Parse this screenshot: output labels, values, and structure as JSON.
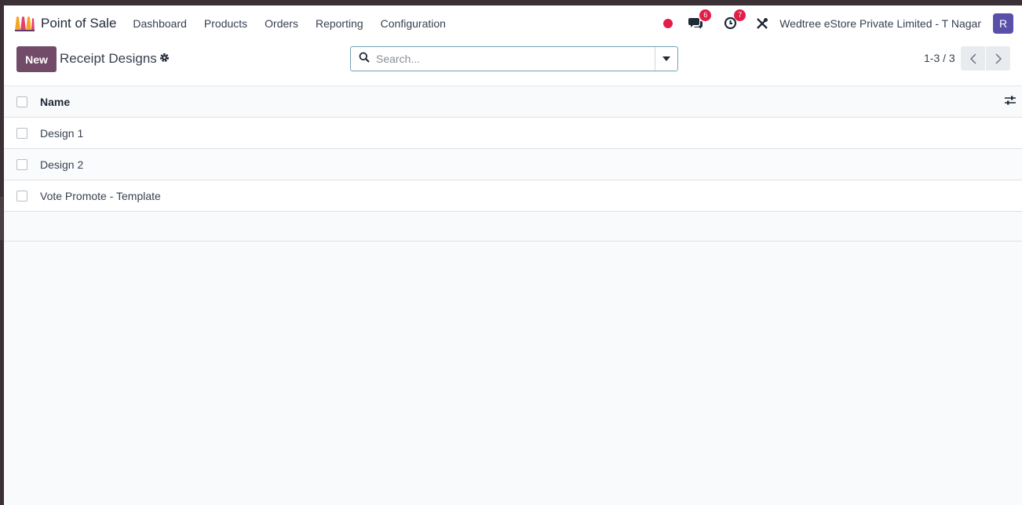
{
  "app": {
    "name": "Point of Sale"
  },
  "nav": {
    "items": [
      {
        "label": "Dashboard"
      },
      {
        "label": "Products"
      },
      {
        "label": "Orders"
      },
      {
        "label": "Reporting"
      },
      {
        "label": "Configuration"
      }
    ]
  },
  "systray": {
    "messages_count": "6",
    "activities_count": "7",
    "company": "Wedtree eStore Private Limited - T Nagar",
    "avatar_initial": "R"
  },
  "control": {
    "new_label": "New",
    "title": "Receipt Designs",
    "search_placeholder": "Search...",
    "pager": "1-3 / 3"
  },
  "list": {
    "columns": [
      {
        "label": "Name"
      }
    ],
    "rows": [
      {
        "name": "Design 1"
      },
      {
        "name": "Design 2"
      },
      {
        "name": "Vote Promote - Template"
      }
    ]
  },
  "colors": {
    "brand": "#714b67",
    "badge": "#e11d48",
    "avatar": "#5b50a9"
  },
  "icons": [
    "app-logo-icon",
    "record-dot-icon",
    "chat-icon",
    "clock-icon",
    "tools-icon",
    "gear-icon",
    "search-icon",
    "caret-down-icon",
    "chevron-left-icon",
    "chevron-right-icon",
    "sliders-icon"
  ]
}
